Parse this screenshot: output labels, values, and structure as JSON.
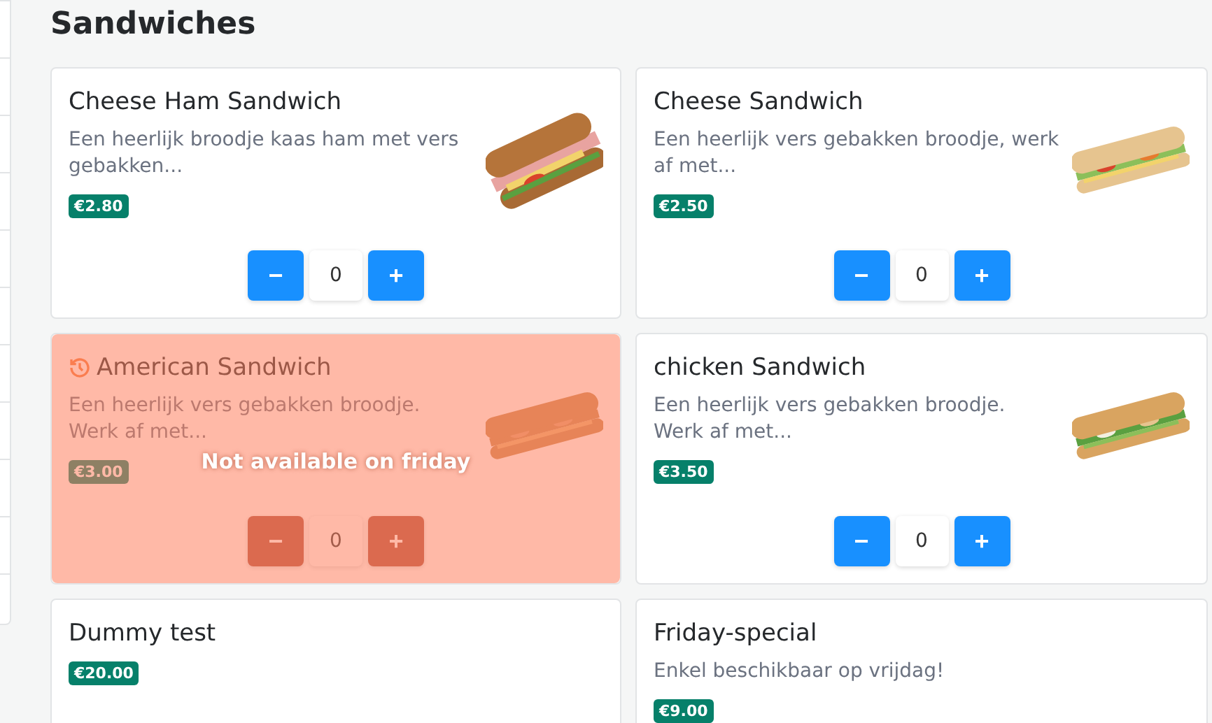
{
  "heading": "Sandwiches",
  "products": [
    {
      "name": "Cheese Ham Sandwich",
      "description": "Een heerlijk broodje kaas ham met vers gebakken...",
      "price": "€2.80",
      "decrease": "−",
      "quantity": "0",
      "increase": "+",
      "available": true
    },
    {
      "name": "Cheese Sandwich",
      "description": "Een heerlijk vers gebakken broodje, werk af met...",
      "price": "€2.50",
      "decrease": "−",
      "quantity": "0",
      "increase": "+",
      "available": true
    },
    {
      "name": "American Sandwich",
      "description": "Een heerlijk vers gebakken broodje. Werk af met...",
      "price": "€3.00",
      "decrease": "−",
      "quantity": "0",
      "increase": "+",
      "available": false,
      "unavailable_message": "Not available on friday"
    },
    {
      "name": "chicken Sandwich",
      "description": "Een heerlijk vers gebakken broodje. Werk af met...",
      "price": "€3.50",
      "decrease": "−",
      "quantity": "0",
      "increase": "+",
      "available": true
    },
    {
      "name": "Dummy test",
      "price": "€20.00",
      "available": true
    },
    {
      "name": "Friday-special",
      "description": "Enkel beschikbaar op vrijdag!",
      "price": "€9.00",
      "available": true
    }
  ]
}
